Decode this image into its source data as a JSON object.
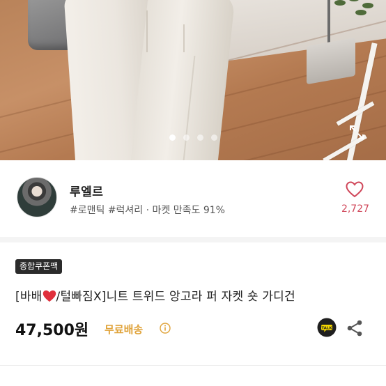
{
  "hero": {
    "slide_count": 4,
    "active_slide": 1
  },
  "seller": {
    "name": "루엘르",
    "tags": "#로맨틱 #럭셔리 · 마켓 만족도 91%",
    "likes": "2,727"
  },
  "product": {
    "coupon_badge": "종합쿠폰팩",
    "title_prefix": "[바배",
    "title_suffix": "/털빠짐X]니트 트위드 앙고라 퍼 자켓 숏 가디건",
    "price": "47,500원",
    "shipping": "무료배송"
  },
  "icons": {
    "like": "heart-outline-icon",
    "title_emoji": "red-heart-icon",
    "talk": "kakao-talk-icon",
    "share": "share-icon",
    "info": "info-icon",
    "expand": "expand-icon"
  },
  "colors": {
    "like_accent": "#d0475a",
    "shipping_accent": "#e0a33a",
    "badge_bg": "#2b2b2b",
    "talk_bg": "#1f1f1f"
  }
}
